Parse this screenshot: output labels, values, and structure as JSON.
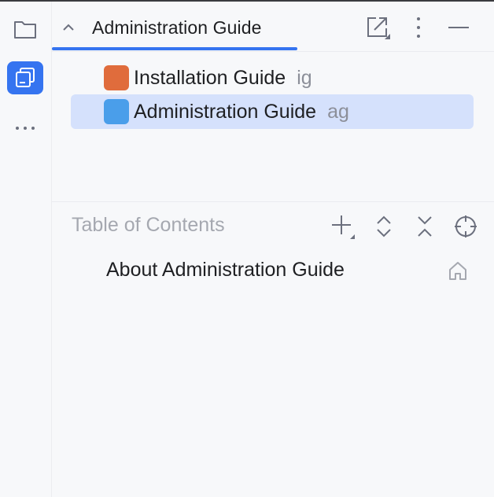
{
  "sidebar": {
    "items": [
      {
        "icon": "folder-icon"
      },
      {
        "icon": "writerside-icon",
        "active": true
      },
      {
        "icon": "more-horizontal-icon"
      }
    ]
  },
  "header": {
    "title": "Administration Guide",
    "icons": [
      "chevron-up-icon",
      "open-in-window-icon",
      "more-vertical-icon",
      "minimize-icon"
    ]
  },
  "tree": {
    "items": [
      {
        "label": "Installation Guide",
        "abbr": "ig",
        "icon_color": "#e06c3c",
        "selected": false
      },
      {
        "label": "Administration Guide",
        "abbr": "ag",
        "icon_color": "#4a9eea",
        "selected": true
      }
    ]
  },
  "toc": {
    "title": "Table of Contents",
    "icons": [
      "add-icon",
      "expand-all-icon",
      "collapse-all-icon",
      "locate-icon"
    ],
    "items": [
      {
        "label": "About Administration Guide",
        "icon": "home-icon"
      }
    ]
  },
  "colors": {
    "accent": "#3574f0",
    "selection": "#d5e1fc",
    "muted_text": "#8c8f99"
  }
}
